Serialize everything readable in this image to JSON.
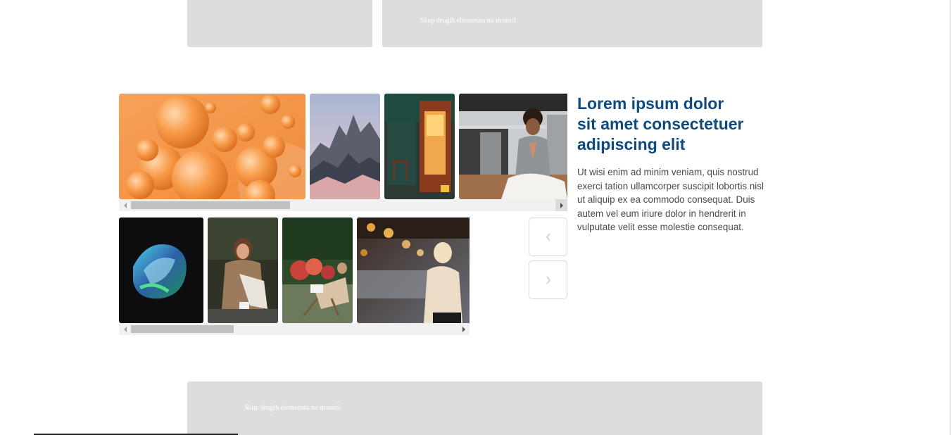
{
  "placeholders": {
    "top_right_text": "Skup drugih elemenata na stranici",
    "bottom_text": "Skup drugih elemenata na stranici."
  },
  "article": {
    "title_lines": [
      "Lorem ipsum dolor",
      "sit amet consectetuer",
      "adipiscing elit"
    ],
    "body_lines": [
      "Ut wisi enim ad minim veniam, quis nostrud",
      "exerci tation ullamcorper suscipit lobortis nisl",
      "ut aliquip ex ea commodo consequat. Duis",
      "autem vel eum iriure dolor in hendrerit in",
      "vulputate velit esse molestie consequat."
    ]
  },
  "gallery": {
    "row1_images": [
      "orange-spheres",
      "mountain-peaks",
      "cafe-interior",
      "woman-meditating"
    ],
    "row2_images": [
      "abstract-3d-shape",
      "woman-sitting-portrait",
      "woman-reading-garden",
      "woman-bokeh-lights"
    ]
  },
  "icons": {
    "prev": "chevron-left-icon",
    "next": "chevron-right-icon"
  }
}
